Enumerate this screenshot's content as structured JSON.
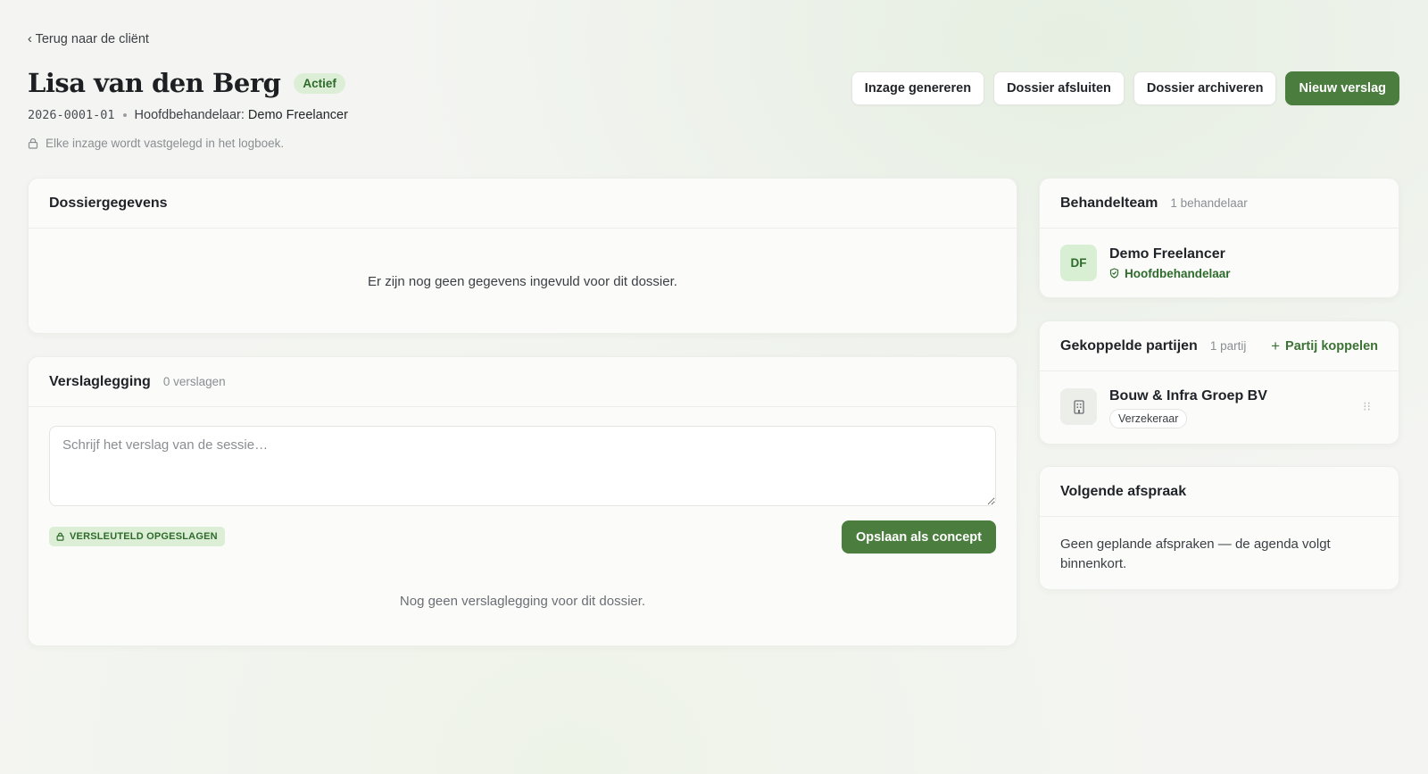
{
  "header": {
    "back_link": "‹ Terug naar de cliënt",
    "title": "Lisa van den Berg",
    "status": "Actief",
    "file_number": "2026-0001-01",
    "lead_label": "Hoofdbehandelaar:",
    "lead_value": "Demo Freelancer",
    "log_notice": "Elke inzage wordt vastgelegd in het logboek."
  },
  "actions": {
    "generate_access": "Inzage genereren",
    "close_file": "Dossier afsluiten",
    "archive_file": "Dossier archiveren",
    "new_report": "Nieuw verslag"
  },
  "dossier": {
    "title": "Dossiergegevens",
    "empty": "Er zijn nog geen gegevens ingevuld voor dit dossier."
  },
  "report": {
    "title": "Verslaglegging",
    "count": "0 verslagen",
    "placeholder": "Schrijf het verslag van de sessie…",
    "encrypted_badge": "VERSLEUTELD OPGESLAGEN",
    "save_concept": "Opslaan als concept",
    "empty": "Nog geen verslaglegging voor dit dossier."
  },
  "team": {
    "title": "Behandelteam",
    "count": "1 behandelaar",
    "members": [
      {
        "initials": "DF",
        "name": "Demo Freelancer",
        "role": "Hoofdbehandelaar"
      }
    ]
  },
  "parties": {
    "title": "Gekoppelde partijen",
    "count": "1 partij",
    "link_action": "Partij koppelen",
    "items": [
      {
        "name": "Bouw & Infra Groep BV",
        "type": "Verzekeraar",
        "icon": "building-icon"
      }
    ]
  },
  "appointment": {
    "title": "Volgende afspraak",
    "text": "Geen geplande afspraken — de agenda volgt binnenkort."
  },
  "colors": {
    "accent": "#4a7d3e",
    "badge_bg": "#dcefd6",
    "badge_text": "#2e6a2b"
  }
}
